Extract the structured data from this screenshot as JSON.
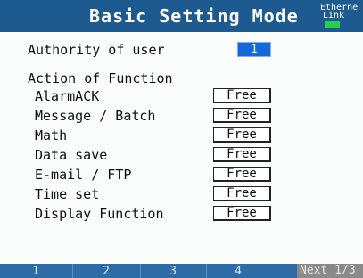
{
  "header": {
    "title": "Basic Setting Mode",
    "ethernet_line1": "Etherne",
    "ethernet_line2": "Link",
    "link_led_color": "#26d04a"
  },
  "authority": {
    "label": "Authority of user",
    "value": "1"
  },
  "action": {
    "heading": "Action of Function",
    "rows": [
      {
        "label": "AlarmACK",
        "value": "Free"
      },
      {
        "label": "Message / Batch",
        "value": "Free"
      },
      {
        "label": "Math",
        "value": "Free"
      },
      {
        "label": "Data save",
        "value": "Free"
      },
      {
        "label": "E-mail / FTP",
        "value": "Free"
      },
      {
        "label": "Time set",
        "value": "Free"
      },
      {
        "label": "Display Function",
        "value": "Free"
      }
    ]
  },
  "softkeys": {
    "keys": [
      "1",
      "2",
      "3",
      "4"
    ],
    "next": "Next 1/3"
  },
  "colors": {
    "header_bg": "#1d5a90",
    "selected_value_bg": "#1468d8",
    "softkey_bar": "#2d6ca4",
    "next_bg": "#8a8a8a"
  }
}
